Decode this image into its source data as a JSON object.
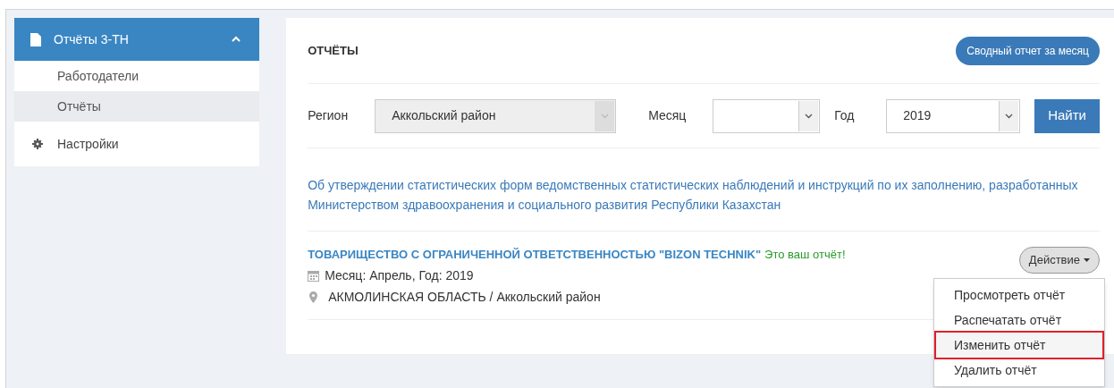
{
  "sidebar": {
    "items": [
      {
        "label": "Отчёты 3-ТН",
        "kind": "group",
        "expanded": true,
        "children": [
          {
            "label": "Работодатели",
            "selected": false
          },
          {
            "label": "Отчёты",
            "selected": true
          }
        ]
      },
      {
        "label": "Настройки",
        "kind": "link"
      }
    ]
  },
  "panel": {
    "title": "ОТЧЁТЫ",
    "summary_button": "Сводный отчет за месяц"
  },
  "filters": {
    "region": {
      "label": "Регион",
      "value": "Аккольский район",
      "disabled": true
    },
    "month": {
      "label": "Месяц"
    },
    "year": {
      "label": "Год",
      "value": "2019"
    },
    "search_button": "Найти"
  },
  "notice": "Об утверждении статистических форм ведомственных статистических наблюдений и инструкций по их заполнению, разработанных Министерством здравоохранения и социального развития Республики Казахстан",
  "reports": [
    {
      "company": "ТОВАРИЩЕСТВО С ОГРАНИЧЕННОЙ ОТВЕТСТВЕННОСТЬЮ \"BIZON TECHNIK\"",
      "own_note": "Это ваш отчёт!",
      "period": "Месяц: Апрель, Год: 2019",
      "location": "АКМОЛИНСКАЯ ОБЛАСТЬ / Аккольский район",
      "action_button": "Действие",
      "menu": [
        {
          "label": "Просмотреть отчёт",
          "highlighted": false
        },
        {
          "label": "Распечатать отчёт",
          "highlighted": false
        },
        {
          "label": "Изменить отчёт",
          "highlighted": true
        },
        {
          "label": "Удалить отчёт",
          "highlighted": false
        }
      ]
    }
  ]
}
